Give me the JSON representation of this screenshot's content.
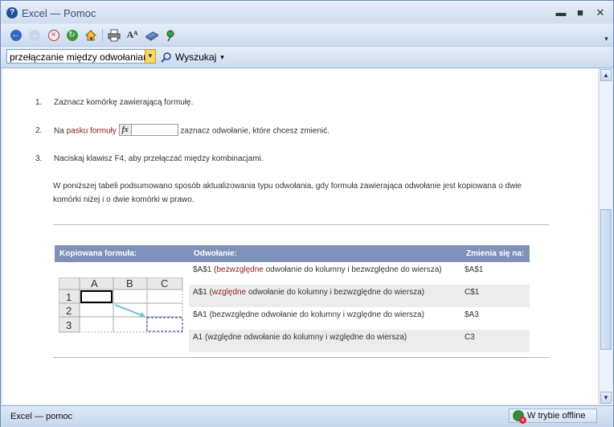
{
  "window": {
    "title": "Excel — Pomoc",
    "minimize_label": "▬",
    "maximize_label": "■",
    "close_label": "✕"
  },
  "toolbar": {
    "search_value": "przełączanie między odwołaniami",
    "search_label": "Wyszukaj",
    "search_arrow": "▾",
    "overflow_label": "▾"
  },
  "content": {
    "steps": [
      {
        "num": "1.",
        "text": "Zaznacz komórkę zawierającą formułę."
      },
      {
        "num": "2.",
        "before": "Na",
        "link": "pasku formuły",
        "after": "zaznacz odwołanie, które chcesz zmienić."
      },
      {
        "num": "3.",
        "text": "Naciskaj klawisz F4, aby przełączać między kombinacjami."
      }
    ],
    "fx_label": "fx",
    "paragraph": "W poniższej tabeli podsumowano sposób aktualizowania typu odwołania, gdy formuła zawierająca odwołanie jest kopiowana o dwie komórki niżej i o dwie komórki w prawo.",
    "table": {
      "headers": [
        "Kopiowana formuła:",
        "Odwołanie:",
        "Zmienia się na:"
      ],
      "rows": [
        {
          "ref": "$A$1",
          "open": " (",
          "kind": "bezwzględne",
          "desc": " odwołanie do kolumny i bezwzględne do wiersza)",
          "result": "$A$1"
        },
        {
          "ref": "A$1",
          "open": " (",
          "kind": "względne",
          "desc": " odwołanie do kolumny i bezwzględne do wiersza)",
          "result": "C$1"
        },
        {
          "ref": "$A1",
          "open": " ",
          "kind": "",
          "desc": "(bezwzględne odwołanie do kolumny i względne do wiersza)",
          "result": "$A3"
        },
        {
          "ref": "A1",
          "open": " ",
          "kind": "",
          "desc": "(względne odwołanie do kolumny i względne do wiersza)",
          "result": "C3"
        }
      ]
    },
    "sheet": {
      "columns": [
        "A",
        "B",
        "C"
      ],
      "rows": [
        "1",
        "2",
        "3"
      ]
    }
  },
  "status": {
    "left": "Excel — pomoc",
    "right": "W trybie offline"
  },
  "colors": {
    "header_bg": "#7d91b9",
    "link_red": "#8b1c1c",
    "row_shade": "#ececec",
    "chrome": "#dbe6f4"
  },
  "icons": [
    "help-icon",
    "back-icon",
    "forward-icon",
    "stop-icon",
    "refresh-icon",
    "home-icon",
    "print-icon",
    "text-size-icon",
    "book-icon",
    "keep-on-top-icon",
    "search-icon",
    "offline-icon"
  ]
}
